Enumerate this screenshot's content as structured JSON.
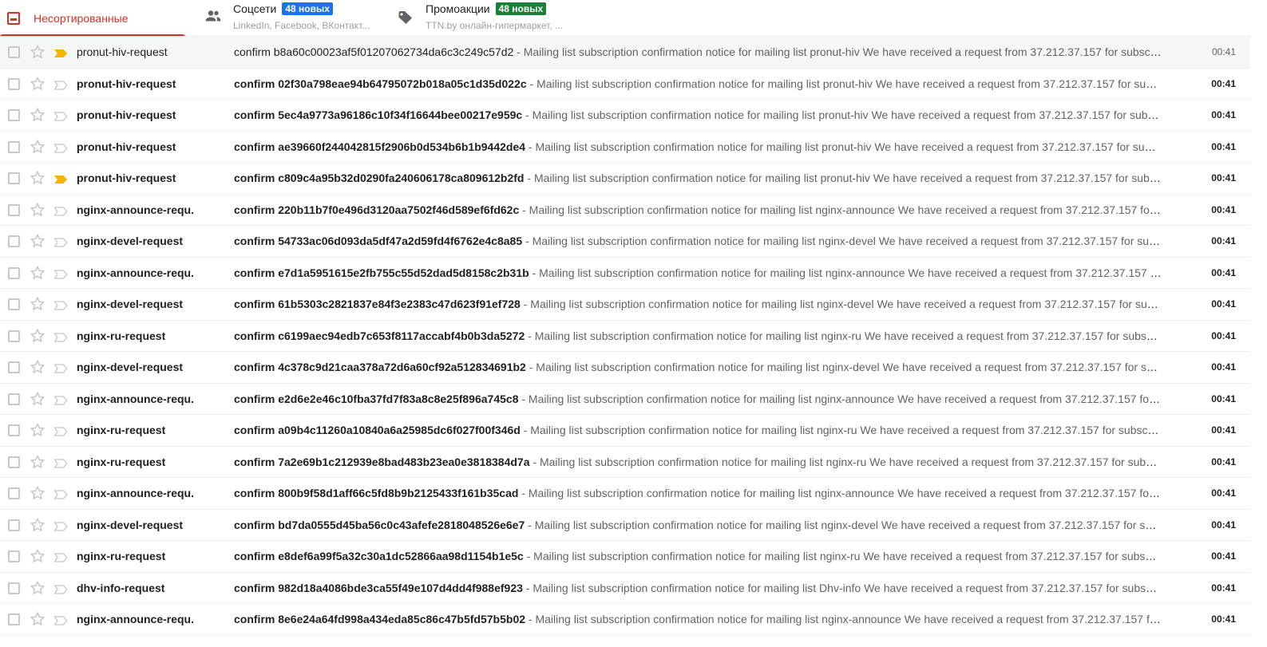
{
  "tabs": [
    {
      "label": "Несортированные"
    },
    {
      "label": "Соцсети",
      "badge": "48 новых",
      "snippet": "LinkedIn, Facebook, ВКонтакт..."
    },
    {
      "label": "Промоакции",
      "badge": "48 новых",
      "snippet": "TTN.by онлайн-гипермаркет, ..."
    }
  ],
  "colors": {
    "accent": "#d93025",
    "badge_social": "#1a73e8",
    "badge_promo": "#188038",
    "important_marker": "#f4b400"
  },
  "icons": {
    "primary_tab": "inbox-icon",
    "social_tab": "people-icon",
    "promo_tab": "tag-icon",
    "star": "star-icon",
    "important": "importance-marker-icon"
  },
  "messages": [
    {
      "sender": "pronut-hiv-request",
      "subject": "confirm b8a60c00023af5f01207062734da6c3c249c57d2",
      "snippet": " - Mailing list subscription confirmation notice for mailing list pronut-hiv We have received a request from 37.212.37.157 for subscription",
      "time": "00:41",
      "read": true,
      "important": true
    },
    {
      "sender": "pronut-hiv-request",
      "subject": "confirm 02f30a798eae94b64795072b018a05c1d35d022c",
      "snippet": " - Mailing list subscription confirmation notice for mailing list pronut-hiv We have received a request from 37.212.37.157 for subscription",
      "time": "00:41",
      "read": false,
      "important": false
    },
    {
      "sender": "pronut-hiv-request",
      "subject": "confirm 5ec4a9773a96186c10f34f16644bee00217e959c",
      "snippet": " - Mailing list subscription confirmation notice for mailing list pronut-hiv We have received a request from 37.212.37.157 for subscription",
      "time": "00:41",
      "read": false,
      "important": false
    },
    {
      "sender": "pronut-hiv-request",
      "subject": "confirm ae39660f244042815f2906b0d534b6b1b9442de4",
      "snippet": " - Mailing list subscription confirmation notice for mailing list pronut-hiv We have received a request from 37.212.37.157 for subscription",
      "time": "00:41",
      "read": false,
      "important": false
    },
    {
      "sender": "pronut-hiv-request",
      "subject": "confirm c809c4a95b32d0290fa240606178ca809612b2fd",
      "snippet": " - Mailing list subscription confirmation notice for mailing list pronut-hiv We have received a request from 37.212.37.157 for subscription",
      "time": "00:41",
      "read": false,
      "important": true
    },
    {
      "sender": "nginx-announce-requ.",
      "subject": "confirm 220b11b7f0e496d3120aa7502f46d589ef6fd62c",
      "snippet": " - Mailing list subscription confirmation notice for mailing list nginx-announce We have received a request from 37.212.37.157 for subscription",
      "time": "00:41",
      "read": false,
      "important": false
    },
    {
      "sender": "nginx-devel-request",
      "subject": "confirm 54733ac06d093da5df47a2d59fd4f6762e4c8a85",
      "snippet": " - Mailing list subscription confirmation notice for mailing list nginx-devel We have received a request from 37.212.37.157 for subscription",
      "time": "00:41",
      "read": false,
      "important": false
    },
    {
      "sender": "nginx-announce-requ.",
      "subject": "confirm e7d1a5951615e2fb755c55d52dad5d8158c2b31b",
      "snippet": " - Mailing list subscription confirmation notice for mailing list nginx-announce We have received a request from 37.212.37.157 for subscription",
      "time": "00:41",
      "read": false,
      "important": false
    },
    {
      "sender": "nginx-devel-request",
      "subject": "confirm 61b5303c2821837e84f3e2383c47d623f91ef728",
      "snippet": " - Mailing list subscription confirmation notice for mailing list nginx-devel We have received a request from 37.212.37.157 for subscription",
      "time": "00:41",
      "read": false,
      "important": false
    },
    {
      "sender": "nginx-ru-request",
      "subject": "confirm c6199aec94edb7c653f8117accabf4b0b3da5272",
      "snippet": " - Mailing list subscription confirmation notice for mailing list nginx-ru We have received a request from 37.212.37.157 for subscription",
      "time": "00:41",
      "read": false,
      "important": false
    },
    {
      "sender": "nginx-devel-request",
      "subject": "confirm 4c378c9d21caa378a72d6a60cf92a512834691b2",
      "snippet": " - Mailing list subscription confirmation notice for mailing list nginx-devel We have received a request from 37.212.37.157 for subscription",
      "time": "00:41",
      "read": false,
      "important": false
    },
    {
      "sender": "nginx-announce-requ.",
      "subject": "confirm e2d6e2e46c10fba37fd7f83a8c8e25f896a745c8",
      "snippet": " - Mailing list subscription confirmation notice for mailing list nginx-announce We have received a request from 37.212.37.157 for subscription",
      "time": "00:41",
      "read": false,
      "important": false
    },
    {
      "sender": "nginx-ru-request",
      "subject": "confirm a09b4c11260a10840a6a25985dc6f027f00f346d",
      "snippet": " - Mailing list subscription confirmation notice for mailing list nginx-ru We have received a request from 37.212.37.157 for subscription",
      "time": "00:41",
      "read": false,
      "important": false
    },
    {
      "sender": "nginx-ru-request",
      "subject": "confirm 7a2e69b1c212939e8bad483b23ea0e3818384d7a",
      "snippet": " - Mailing list subscription confirmation notice for mailing list nginx-ru We have received a request from 37.212.37.157 for subscription",
      "time": "00:41",
      "read": false,
      "important": false
    },
    {
      "sender": "nginx-announce-requ.",
      "subject": "confirm 800b9f58d1aff66c5fd8b9b2125433f161b35cad",
      "snippet": " - Mailing list subscription confirmation notice for mailing list nginx-announce We have received a request from 37.212.37.157 for subscription",
      "time": "00:41",
      "read": false,
      "important": false
    },
    {
      "sender": "nginx-devel-request",
      "subject": "confirm bd7da0555d45ba56c0c43afefe2818048526e6e7",
      "snippet": " - Mailing list subscription confirmation notice for mailing list nginx-devel We have received a request from 37.212.37.157 for subscription",
      "time": "00:41",
      "read": false,
      "important": false
    },
    {
      "sender": "nginx-ru-request",
      "subject": "confirm e8def6a99f5a32c30a1dc52866aa98d1154b1e5c",
      "snippet": " - Mailing list subscription confirmation notice for mailing list nginx-ru We have received a request from 37.212.37.157 for subscription",
      "time": "00:41",
      "read": false,
      "important": false
    },
    {
      "sender": "dhv-info-request",
      "subject": "confirm 982d18a4086bde3ca55f49e107d4dd4f988ef923",
      "snippet": " - Mailing list subscription confirmation notice for mailing list Dhv-info We have received a request from 37.212.37.157 for subscription",
      "time": "00:41",
      "read": false,
      "important": false
    },
    {
      "sender": "nginx-announce-requ.",
      "subject": "confirm 8e6e24a64fd998a434eda85c86c47b5fd57b5b02",
      "snippet": " - Mailing list subscription confirmation notice for mailing list nginx-announce We have received a request from 37.212.37.157 for subscription",
      "time": "00:41",
      "read": false,
      "important": false
    }
  ]
}
